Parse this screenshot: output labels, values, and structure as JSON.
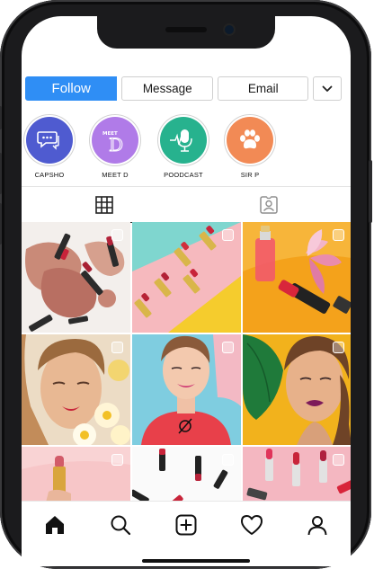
{
  "profile_actions": {
    "follow_label": "Follow",
    "message_label": "Message",
    "email_label": "Email",
    "more_icon": "chevron-down-icon"
  },
  "highlights": [
    {
      "label": "CAPSHO",
      "icon": "chat-bubble-icon",
      "color": "#4f5bd0"
    },
    {
      "label": "MEET D",
      "icon": "meet-d-logo",
      "color": "#b07be8",
      "logo_text": "MEET D"
    },
    {
      "label": "POODCAST",
      "icon": "microphone-icon",
      "color": "#27b28e"
    },
    {
      "label": "SIR P",
      "icon": "paw-icon",
      "color": "#f28a55"
    }
  ],
  "tabs": [
    {
      "name": "grid-tab",
      "icon": "grid-icon",
      "active": true
    },
    {
      "name": "tagged-tab",
      "icon": "tagged-portrait-icon",
      "active": false
    }
  ],
  "posts": [
    {
      "subject": "crushed blush and lipsticks",
      "bg": "#f3efec"
    },
    {
      "subject": "lipsticks on pink and yellow",
      "bg": "#f6b9be"
    },
    {
      "subject": "lipstick and perfume with magnolia",
      "bg": "#f4a21b"
    },
    {
      "subject": "woman with flowers",
      "bg": "#ecdcc5"
    },
    {
      "subject": "woman in red shirt on blue",
      "bg": "#7fcde0"
    },
    {
      "subject": "woman with leaf on yellow",
      "bg": "#f2b21c"
    },
    {
      "subject": "hand holding gold lipstick",
      "bg": "#f7c6c8"
    },
    {
      "subject": "lipsticks on white",
      "bg": "#fafafa"
    },
    {
      "subject": "lipsticks on pink",
      "bg": "#f4b7c1"
    }
  ],
  "bottom_nav": [
    {
      "name": "nav-home",
      "icon": "home-icon",
      "active": true
    },
    {
      "name": "nav-search",
      "icon": "search-icon",
      "active": false
    },
    {
      "name": "nav-add",
      "icon": "add-post-icon",
      "active": false
    },
    {
      "name": "nav-activity",
      "icon": "heart-icon",
      "active": false
    },
    {
      "name": "nav-profile",
      "icon": "profile-icon",
      "active": false
    }
  ],
  "colors": {
    "follow_blue": "#2f8ef5",
    "text": "#1a1a1a",
    "border": "#cfcfcf"
  }
}
